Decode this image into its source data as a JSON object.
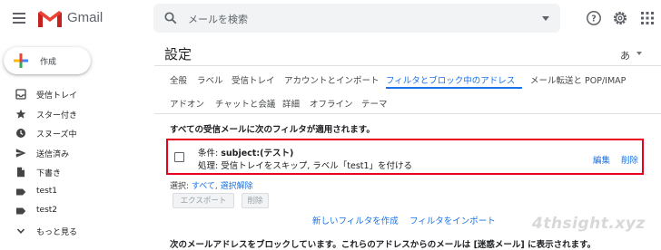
{
  "app": {
    "name": "Gmail"
  },
  "search": {
    "placeholder": "メールを検索"
  },
  "compose": {
    "label": "作成"
  },
  "sidebar": {
    "items": [
      {
        "label": "受信トレイ",
        "icon": "inbox-icon"
      },
      {
        "label": "スター付き",
        "icon": "star-icon"
      },
      {
        "label": "スヌーズ中",
        "icon": "clock-icon"
      },
      {
        "label": "送信済み",
        "icon": "send-icon"
      },
      {
        "label": "下書き",
        "icon": "draft-icon"
      },
      {
        "label": "test1",
        "icon": "label-icon"
      },
      {
        "label": "test2",
        "icon": "label-icon"
      },
      {
        "label": "もっと見る",
        "icon": "chevron-down-icon"
      }
    ]
  },
  "settings": {
    "title": "設定",
    "lang": "あ",
    "tabs_row1": [
      {
        "label": "全般"
      },
      {
        "label": "ラベル"
      },
      {
        "label": "受信トレイ"
      },
      {
        "label": "アカウントとインポート"
      },
      {
        "label": "フィルタとブロック中のアドレス",
        "active": true
      },
      {
        "label": "メール転送と POP/IMAP"
      }
    ],
    "tabs_row2": [
      {
        "label": "アドオン"
      },
      {
        "label": "チャットと会議"
      },
      {
        "label": "詳細"
      },
      {
        "label": "オフライン"
      },
      {
        "label": "テーマ"
      }
    ],
    "filters_heading": "すべての受信メールに次のフィルタが適用されます。",
    "filter": {
      "criteria_prefix": "条件: ",
      "criteria_value": "subject:(テスト)",
      "action": "処理: 受信トレイをスキップ, ラベル「test1」を付ける",
      "edit": "編集",
      "delete": "削除"
    },
    "select": {
      "prefix": "選択: ",
      "all": "すべて",
      "sep": ", ",
      "none": "選択解除"
    },
    "buttons": {
      "export": "エクスポート",
      "delete": "削除"
    },
    "links": {
      "create": "新しいフィルタを作成",
      "import": "フィルタをインポート"
    },
    "blocked_text": "次のメールアドレスをブロックしています。これらのアドレスからのメールは [迷惑メール] に表示されます。"
  },
  "watermark": "4thsight.xyz",
  "colors": {
    "accent": "#1a73e8",
    "highlight_border": "#e8001c"
  }
}
